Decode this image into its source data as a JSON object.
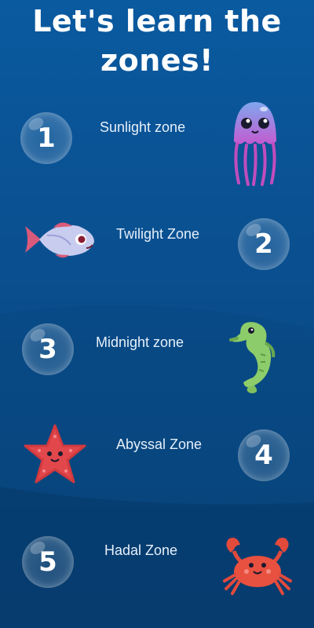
{
  "title": {
    "line1": "Let's learn the",
    "line2": "zones!"
  },
  "zones": [
    {
      "number": "1",
      "label": "Sunlight zone",
      "creature": "jellyfish-icon"
    },
    {
      "number": "2",
      "label": "Twilight Zone",
      "creature": "fish-icon"
    },
    {
      "number": "3",
      "label": "Midnight zone",
      "creature": "seahorse-icon"
    },
    {
      "number": "4",
      "label": "Abyssal Zone",
      "creature": "starfish-icon"
    },
    {
      "number": "5",
      "label": "Hadal Zone",
      "creature": "crab-icon"
    }
  ],
  "colors": {
    "background_top": "#0a5aa0",
    "background_bottom": "#052f58",
    "text": "#ffffff"
  }
}
